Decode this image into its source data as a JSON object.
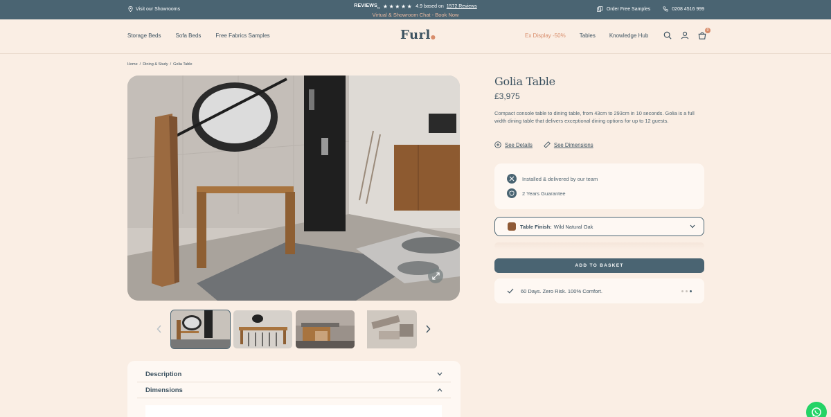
{
  "topbar": {
    "showrooms": "Visit our Showrooms",
    "reviews_logo": "REVIEWS",
    "reviews_logo_suffix": "io",
    "stars": "★★★★★",
    "rating_text": "4.9 based on",
    "reviews_link": "1572 Reviews",
    "promo": "Virtual & Showroom Chat - Book Now",
    "samples": "Order Free Samples",
    "phone": "0208 4516 999"
  },
  "header": {
    "nav_left": [
      "Storage Beds",
      "Sofa Beds",
      "Free Fabrics Samples"
    ],
    "logo": "Furl",
    "nav_right": [
      "Ex Display -50%",
      "Tables",
      "Knowledge Hub"
    ],
    "basket_count": "0"
  },
  "breadcrumb": [
    "Home",
    "/",
    "Dining & Study",
    "/",
    "Golia Table"
  ],
  "product": {
    "title": "Golia Table",
    "price": "£3,975",
    "description": "Compact console table to dining table, from 43cm to 293cm in 10 seconds. Golia is a full width dining table that delivers exceptional dining options for up to 12 guests.",
    "see_details": "See Details",
    "see_dimensions": "See Dimensions",
    "benefits": [
      "Installed & delivered by our team",
      "2 Years Guarantee"
    ],
    "finish_label": "Table Finish:",
    "finish_value": "Wild Natural Oak",
    "add_to_basket": "ADD TO BASKET",
    "guarantee": "60 Days. Zero Risk. 100% Comfort."
  },
  "accordion": [
    "Description",
    "Dimensions"
  ],
  "colors": {
    "primary": "#4a6472",
    "accent": "#d88c6a",
    "background": "#faeee4",
    "card": "#fef8f3"
  }
}
